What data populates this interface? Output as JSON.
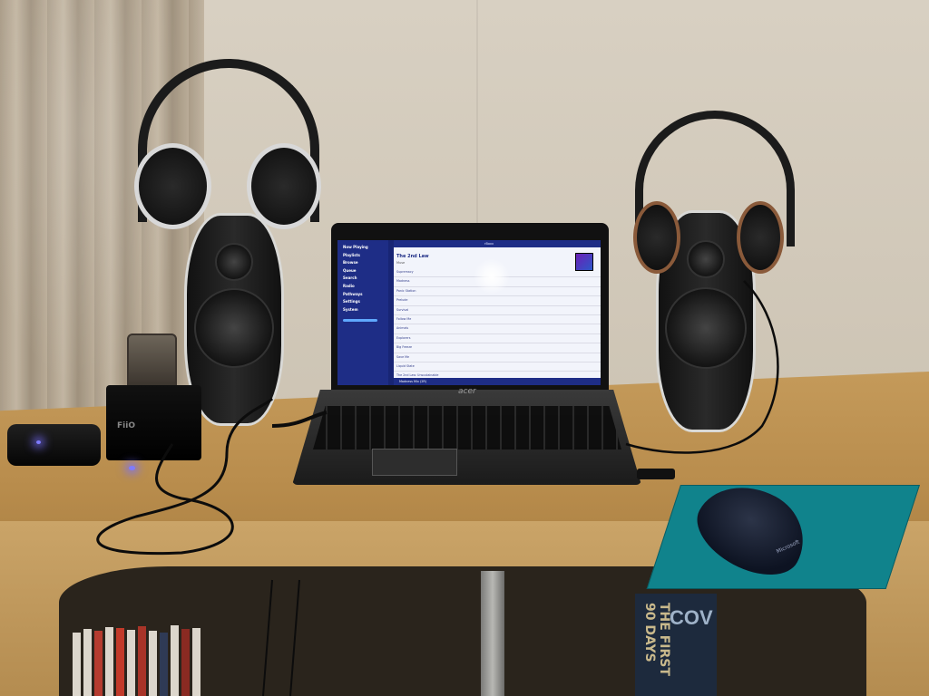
{
  "laptop": {
    "brand": "acer",
    "screen": {
      "app_title": "rBoxx",
      "sidebar": [
        "Now Playing",
        "Playlists",
        "Browse",
        "Queue",
        "Search",
        "Radio",
        "Pathways",
        "Settings",
        "System"
      ],
      "current_title": "The 2nd Law",
      "current_sub": "Muse",
      "tracks": [
        "Supremacy",
        "Madness",
        "Panic Station",
        "Prelude",
        "Survival",
        "Follow Me",
        "Animals",
        "Explorers",
        "Big Freeze",
        "Save Me",
        "Liquid State",
        "The 2nd Law: Unsustainable"
      ],
      "now_playing_bar": "Madness Mix (2R)"
    }
  },
  "dac": {
    "label": "FiiO"
  },
  "mouse": {
    "brand": "Microsoft"
  },
  "book": {
    "spine_text": "THE FIRST 90 DAYS"
  },
  "book_cover": {
    "text": "COV"
  }
}
